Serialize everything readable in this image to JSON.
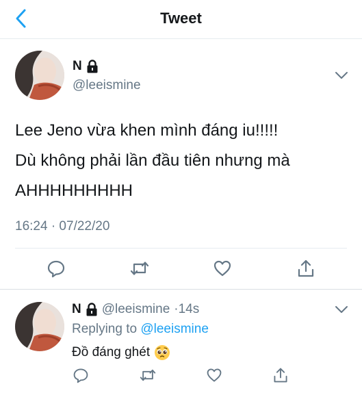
{
  "header": {
    "title": "Tweet"
  },
  "tweet": {
    "author_name": "N",
    "author_handle": "@leeismine",
    "text_lines": [
      "Lee Jeno vừa khen mình đáng iu!!!!!",
      "Dù không phải lần đầu tiên nhưng mà",
      "AHHHHHHHHH"
    ],
    "timestamp": "16:24 · 07/22/20"
  },
  "reply": {
    "author_name": "N",
    "author_handle": "@leeismine",
    "time_sep": "·",
    "time": "14s",
    "replying_label": "Replying to",
    "replying_handle": "@leeismine",
    "text": "Đồ đáng ghét"
  },
  "colors": {
    "accent": "#1da1f2",
    "muted": "#657786",
    "divider": "#e6ecf0"
  },
  "icons": [
    "back-chevron-icon",
    "lock-icon",
    "chevron-down-icon",
    "reply-icon",
    "retweet-icon",
    "like-icon",
    "share-icon",
    "pleading-face-emoji"
  ]
}
